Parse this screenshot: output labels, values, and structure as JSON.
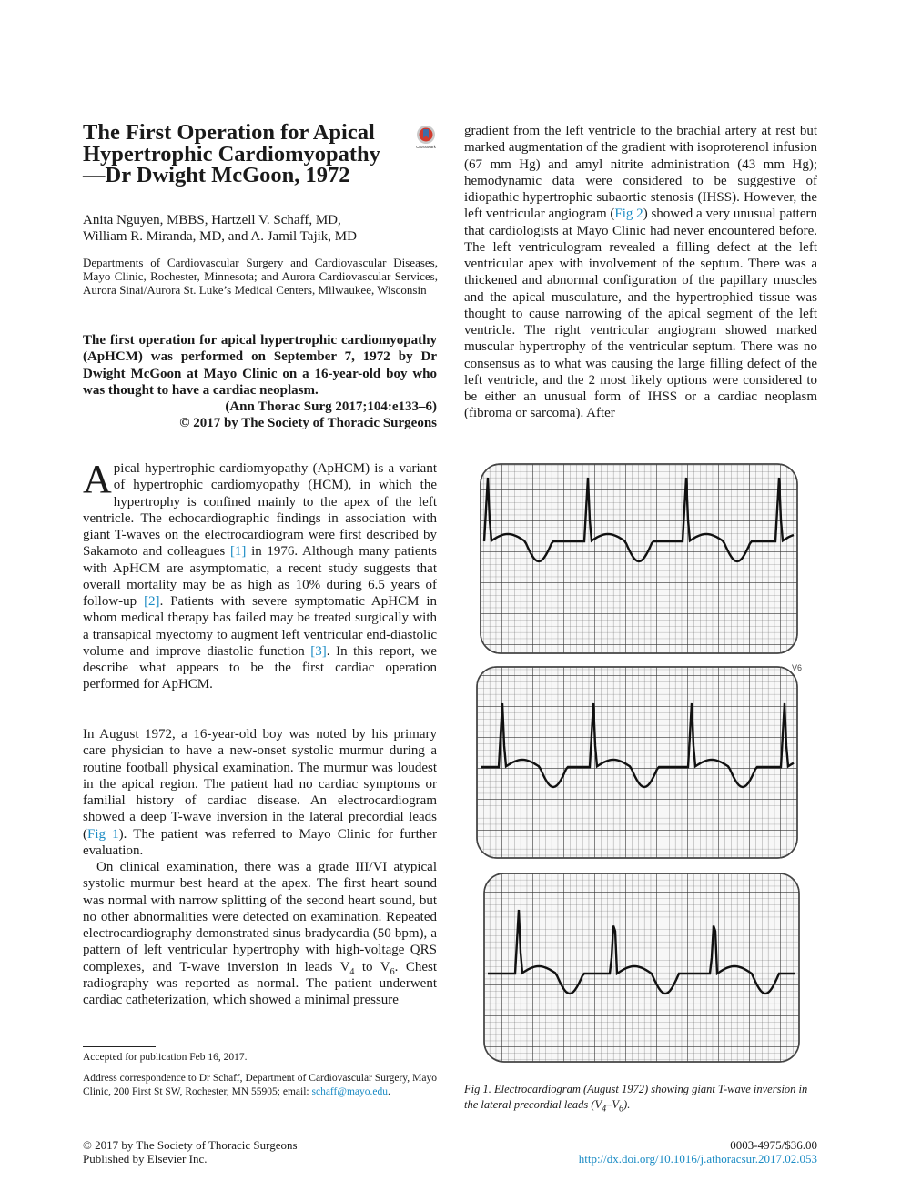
{
  "title": "The First Operation for Apical Hypertrophic Cardiomyopathy—Dr Dwight McGoon, 1972",
  "crossmark_label": "CrossMark",
  "authors": {
    "line1": "Anita Nguyen, MBBS, Hartzell V. Schaff, MD,",
    "line2": "William R. Miranda, MD, and A. Jamil Tajik, MD"
  },
  "affiliation": "Departments of Cardiovascular Surgery and Cardiovascular Diseases, Mayo Clinic, Rochester, Minnesota; and Aurora Cardiovascular Services, Aurora Sinai/Aurora St. Luke’s Medical Centers, Milwaukee, Wisconsin",
  "abstract": {
    "text": "The first operation for apical hypertrophic cardiomyopathy (ApHCM) was performed on September 7, 1972 by Dr Dwight McGoon at Mayo Clinic on a 16-year-old boy who was thought to have a cardiac neoplasm.",
    "citation": "(Ann Thorac Surg 2017;104:e133–6)",
    "copyright": "© 2017 by The Society of Thoracic Surgeons"
  },
  "p1": {
    "dropcap": "A",
    "a": "pical hypertrophic cardiomyopathy (ApHCM) is a variant of hypertrophic cardiomyopathy (HCM), in which the hypertrophy is confined mainly to the apex of the left ventricle. The echocardiographic findings in association with giant T-waves on the electrocardiogram were first described by Sakamoto and colleagues ",
    "ref1": "[1]",
    "b": " in 1976. Although many patients with ApHCM are asymptomatic, a recent study suggests that overall mortality may be as high as 10% during 6.5 years of follow-up ",
    "ref2": "[2]",
    "c": ". Patients with severe symptomatic ApHCM in whom medical therapy has failed may be treated surgically with a transapical myectomy to augment left ventricular end-diastolic volume and improve diastolic function ",
    "ref3": "[3]",
    "d": ". In this report, we describe what appears to be the first cardiac operation performed for ApHCM."
  },
  "p2": {
    "a": "In August 1972, a 16-year-old boy was noted by his primary care physician to have a new-onset systolic murmur during a routine football physical examination. The murmur was loudest in the apical region. The patient had no cardiac symptoms or familial history of cardiac disease. An electrocardiogram showed a deep T-wave inversion in the lateral precordial leads (",
    "fig": "Fig 1",
    "b": "). The patient was referred to Mayo Clinic for further evaluation."
  },
  "p3": {
    "a": "On clinical examination, there was a grade III/VI atypical systolic murmur best heard at the apex. The first heart sound was normal with narrow splitting of the second heart sound, but no other abnormalities were detected on examination. Repeated electrocardiography demonstrated sinus bradycardia (50 bpm), a pattern of left ventricular hypertrophy with high-voltage QRS complexes, and T-wave inversion in leads V",
    "sub1": "4",
    "mid": " to V",
    "sub2": "6",
    "b": ". Chest radiography was reported as normal. The patient underwent cardiac catheterization, which showed a minimal pressure"
  },
  "p4": {
    "a": "gradient from the left ventricle to the brachial artery at rest but marked augmentation of the gradient with isoproterenol infusion (67 mm Hg) and amyl nitrite administration (43 mm Hg); hemodynamic data were considered to be suggestive of idiopathic hypertrophic subaortic stenosis (IHSS). However, the left ventricular angiogram (",
    "fig": "Fig 2",
    "b": ") showed a very unusual pattern that cardiologists at Mayo Clinic had never encountered before. The left ventriculogram revealed a filling defect at the left ventricular apex with involvement of the septum. There was a thickened and abnormal configuration of the papillary muscles and the apical musculature, and the hypertrophied tissue was thought to cause narrowing of the apical segment of the left ventricle. The right ventricular angiogram showed marked muscular hypertrophy of the ventricular septum. There was no consensus as to what was causing the large filling defect of the left ventricle, and the 2 most likely options were considered to be either an unusual form of IHSS or a cardiac neoplasm (fibroma or sarcoma). After"
  },
  "figure": {
    "lead_label": "V6",
    "caption_a": "Fig 1.  Electrocardiogram (August 1972) showing giant T-wave inversion in the lateral precordial leads (V",
    "caption_sub1": "4",
    "caption_mid": "–V",
    "caption_sub2": "6",
    "caption_b": ")."
  },
  "footnotes": {
    "accepted": "Accepted for publication Feb 16, 2017.",
    "address": "Address correspondence to Dr Schaff, Department of Cardiovascular Surgery, Mayo Clinic, 200 First St SW, Rochester, MN  55905; email: ",
    "email": "schaff@mayo.edu",
    "address_end": "."
  },
  "footer": {
    "copyright": "© 2017 by The Society of Thoracic Surgeons",
    "publisher": "Published by Elsevier Inc.",
    "issn_price": "0003-4975/$36.00",
    "doi": "http://dx.doi.org/10.1016/j.athoracsur.2017.02.053"
  },
  "colors": {
    "link": "#1a8bc4",
    "ecg_paper": "#f7f7f7",
    "ecg_grid": "#555555",
    "ecg_trace": "#111111"
  }
}
